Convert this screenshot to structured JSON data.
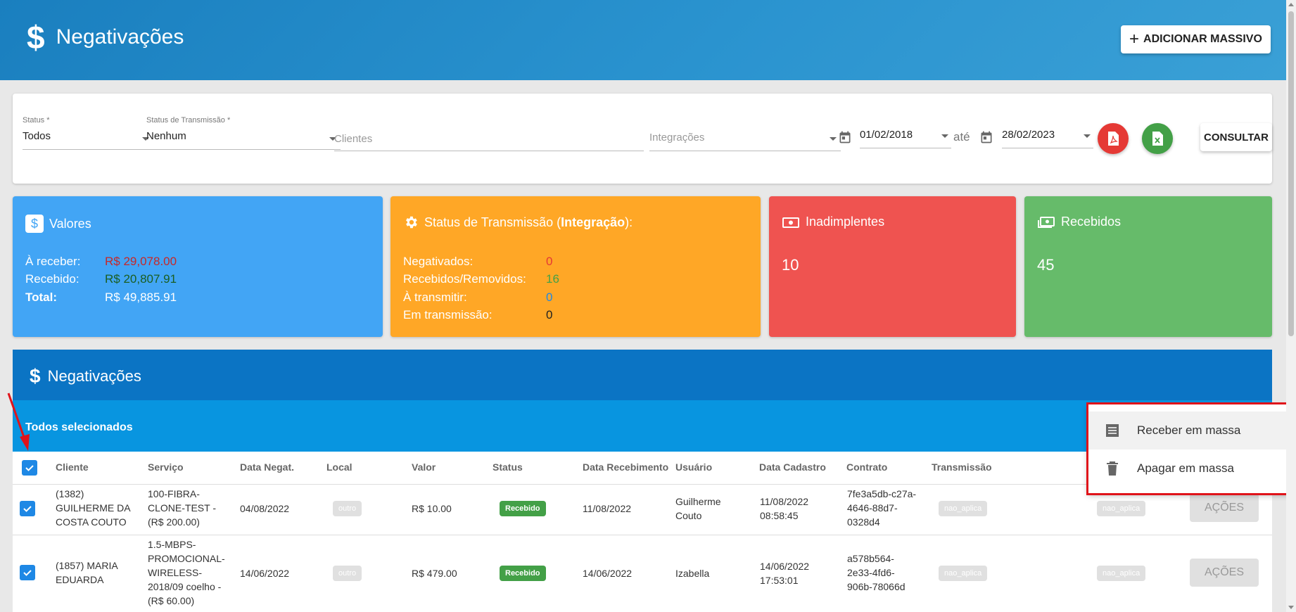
{
  "header": {
    "title": "Negativações",
    "add_button": "ADICIONAR MASSIVO"
  },
  "filters": {
    "status_label": "Status *",
    "status_value": "Todos",
    "transmissao_label": "Status de Transmissão *",
    "transmissao_value": "Nenhum",
    "clientes_placeholder": "Clientes",
    "integracoes_placeholder": "Integrações",
    "date_from": "01/02/2018",
    "ate": "até",
    "date_to": "28/02/2023",
    "consultar": "CONSULTAR"
  },
  "cards": {
    "valores": {
      "title": "Valores",
      "rows": [
        {
          "label": "À receber:",
          "value": "R$ 29,078.00"
        },
        {
          "label": "Recebido:",
          "value": "R$ 20,807.91"
        },
        {
          "label": "Total:",
          "value": "R$ 49,885.91"
        }
      ]
    },
    "transmissao": {
      "title_prefix": "Status de Transmissão (",
      "title_bold": "Integração",
      "title_suffix": "):",
      "rows": [
        {
          "label": "Negativados:",
          "value": "0"
        },
        {
          "label": "Recebidos/Removidos:",
          "value": "16"
        },
        {
          "label": "À transmitir:",
          "value": "0"
        },
        {
          "label": "Em transmissão:",
          "value": "0"
        }
      ]
    },
    "inadimplentes": {
      "title": "Inadimplentes",
      "value": "10"
    },
    "recebidos": {
      "title": "Recebidos",
      "value": "45"
    }
  },
  "list": {
    "title": "Negativações",
    "selection_text": "Todos selecionados",
    "columns": [
      "Cliente",
      "Serviço",
      "Data Negat.",
      "Local",
      "Valor",
      "Status",
      "Data Recebimento",
      "Usuário",
      "Data Cadastro",
      "Contrato",
      "Transmissão"
    ],
    "rows": [
      {
        "cliente": [
          "(1382)",
          "GUILHERME DA",
          "COSTA COUTO"
        ],
        "servico": [
          "100-FIBRA-",
          "CLONE-TEST -",
          "(R$ 200.00)"
        ],
        "data_negat": "04/08/2022",
        "local": "outro",
        "valor": "R$ 10.00",
        "status": "Recebido",
        "data_recebimento": "11/08/2022",
        "usuario": [
          "Guilherme",
          "Couto"
        ],
        "data_cadastro": [
          "11/08/2022",
          "08:58:45"
        ],
        "contrato": [
          "7fe3a5db-c27a-",
          "4646-88d7-",
          "0328d4"
        ],
        "transmissao": "nao_aplica",
        "extra_chip": "nao_aplica",
        "acoes": "AÇÕES"
      },
      {
        "cliente": [
          "(1857) MARIA",
          "EDUARDA"
        ],
        "servico": [
          "1.5-MBPS-",
          "PROMOCIONAL-",
          "WIRELESS-",
          "2018/09 coelho -",
          "(R$ 60.00)"
        ],
        "data_negat": "14/06/2022",
        "local": "outro",
        "valor": "R$ 479.00",
        "status": "Recebido",
        "data_recebimento": "14/06/2022",
        "usuario": [
          "Izabella"
        ],
        "data_cadastro": [
          "14/06/2022",
          "17:53:01"
        ],
        "contrato": [
          "a578b564-",
          "2e33-4fd6-",
          "906b-78066d"
        ],
        "transmissao": "nao_aplica",
        "extra_chip": "nao_aplica",
        "acoes": "AÇÕES"
      }
    ]
  },
  "menu": {
    "items": [
      "Receber em massa",
      "Apagar em massa"
    ]
  },
  "colors": {
    "valores": "#42a5f5",
    "transmissao": "#ffa726",
    "inadimplentes": "#ef5350",
    "recebidos": "#66bb6a"
  }
}
